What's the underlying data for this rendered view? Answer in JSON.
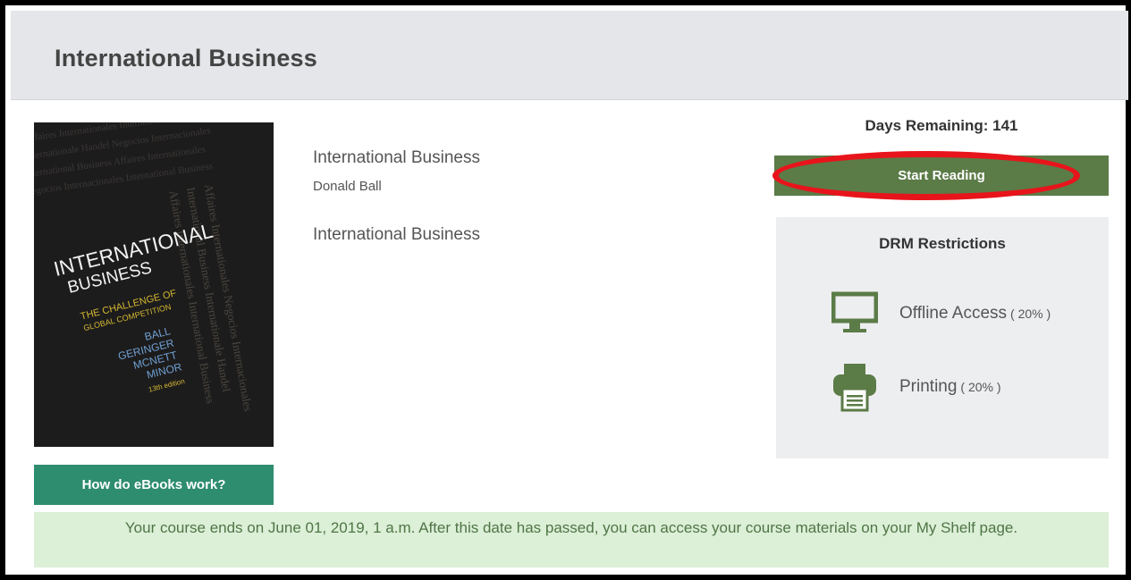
{
  "page": {
    "title": "International Business"
  },
  "book": {
    "title": "International Business",
    "author": "Donald Ball",
    "subject": "International Business",
    "cover": {
      "line1": "INTERNATIONAL",
      "line2": "BUSINESS",
      "subtitle1": "THE CHALLENGE OF",
      "subtitle2": "GLOBAL COMPETITION",
      "authors": [
        "BALL",
        "GERINGER",
        "MCNETT",
        "MINOR"
      ],
      "edition": "13th edition"
    }
  },
  "actions": {
    "how_label": "How do eBooks work?",
    "start_label": "Start Reading",
    "days_remaining": "Days Remaining: 141"
  },
  "drm": {
    "title": "DRM Restrictions",
    "items": [
      {
        "icon": "monitor-icon",
        "label": "Offline Access",
        "pct": "( 20% )"
      },
      {
        "icon": "printer-icon",
        "label": "Printing",
        "pct": "( 20% )"
      }
    ]
  },
  "notice": {
    "text": "Your course ends on June 01, 2019, 1 a.m. After this date has passed, you can access your course materials on your My Shelf page."
  },
  "colors": {
    "accent_green": "#5b7b47",
    "teal_button": "#2e8c6f",
    "highlight_ring": "#e8141b",
    "notice_bg": "#dcefd7"
  }
}
